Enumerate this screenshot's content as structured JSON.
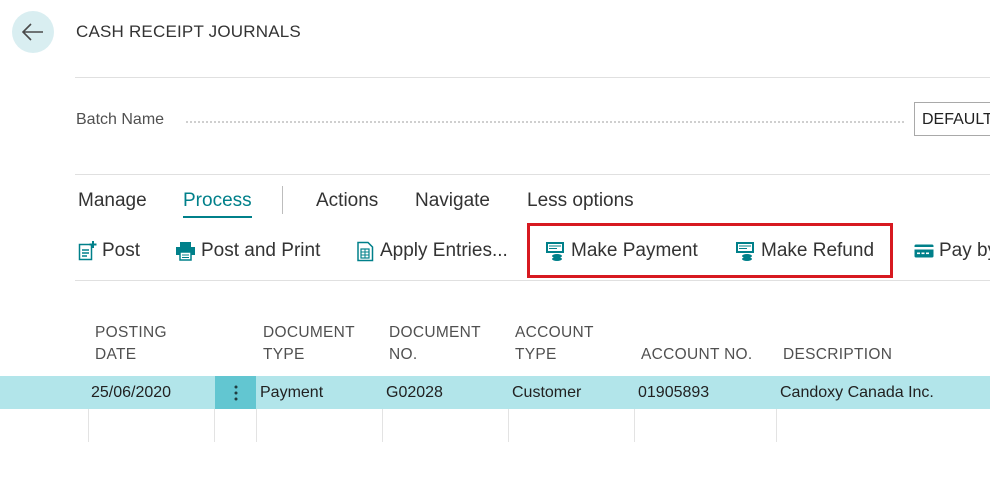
{
  "page": {
    "title": "CASH RECEIPT JOURNALS"
  },
  "batch": {
    "label": "Batch Name",
    "value": "DEFAULT"
  },
  "menu": {
    "items": [
      {
        "label": "Manage",
        "active": false
      },
      {
        "label": "Process",
        "active": true
      },
      {
        "label": "Actions",
        "active": false
      },
      {
        "label": "Navigate",
        "active": false
      },
      {
        "label": "Less options",
        "active": false
      }
    ]
  },
  "actions": {
    "post": "Post",
    "post_and_print": "Post and Print",
    "apply_entries": "Apply Entries...",
    "make_payment": "Make Payment",
    "make_refund": "Make Refund",
    "pay_by": "Pay by"
  },
  "grid": {
    "columns": [
      {
        "line1": "POSTING",
        "line2": "DATE"
      },
      {
        "line1": "DOCUMENT",
        "line2": "TYPE"
      },
      {
        "line1": "DOCUMENT",
        "line2": "NO."
      },
      {
        "line1": "ACCOUNT",
        "line2": "TYPE"
      },
      {
        "line1": "",
        "line2": "ACCOUNT NO."
      },
      {
        "line1": "",
        "line2": "DESCRIPTION"
      }
    ],
    "rows": [
      {
        "posting_date": "25/06/2020",
        "document_type": "Payment",
        "document_no": "G02028",
        "account_type": "Customer",
        "account_no": "01905893",
        "description": "Candoxy Canada Inc."
      }
    ]
  },
  "colors": {
    "accent": "#00808a",
    "selected_row": "#b2e5ea",
    "row_menu": "#62c6d1",
    "highlight": "#d71920",
    "back_button": "#d9eef1"
  },
  "icons": [
    "back-arrow-icon",
    "post-icon",
    "printer-icon",
    "apply-entries-icon",
    "payment-icon",
    "refund-icon",
    "card-icon",
    "row-menu-icon"
  ]
}
